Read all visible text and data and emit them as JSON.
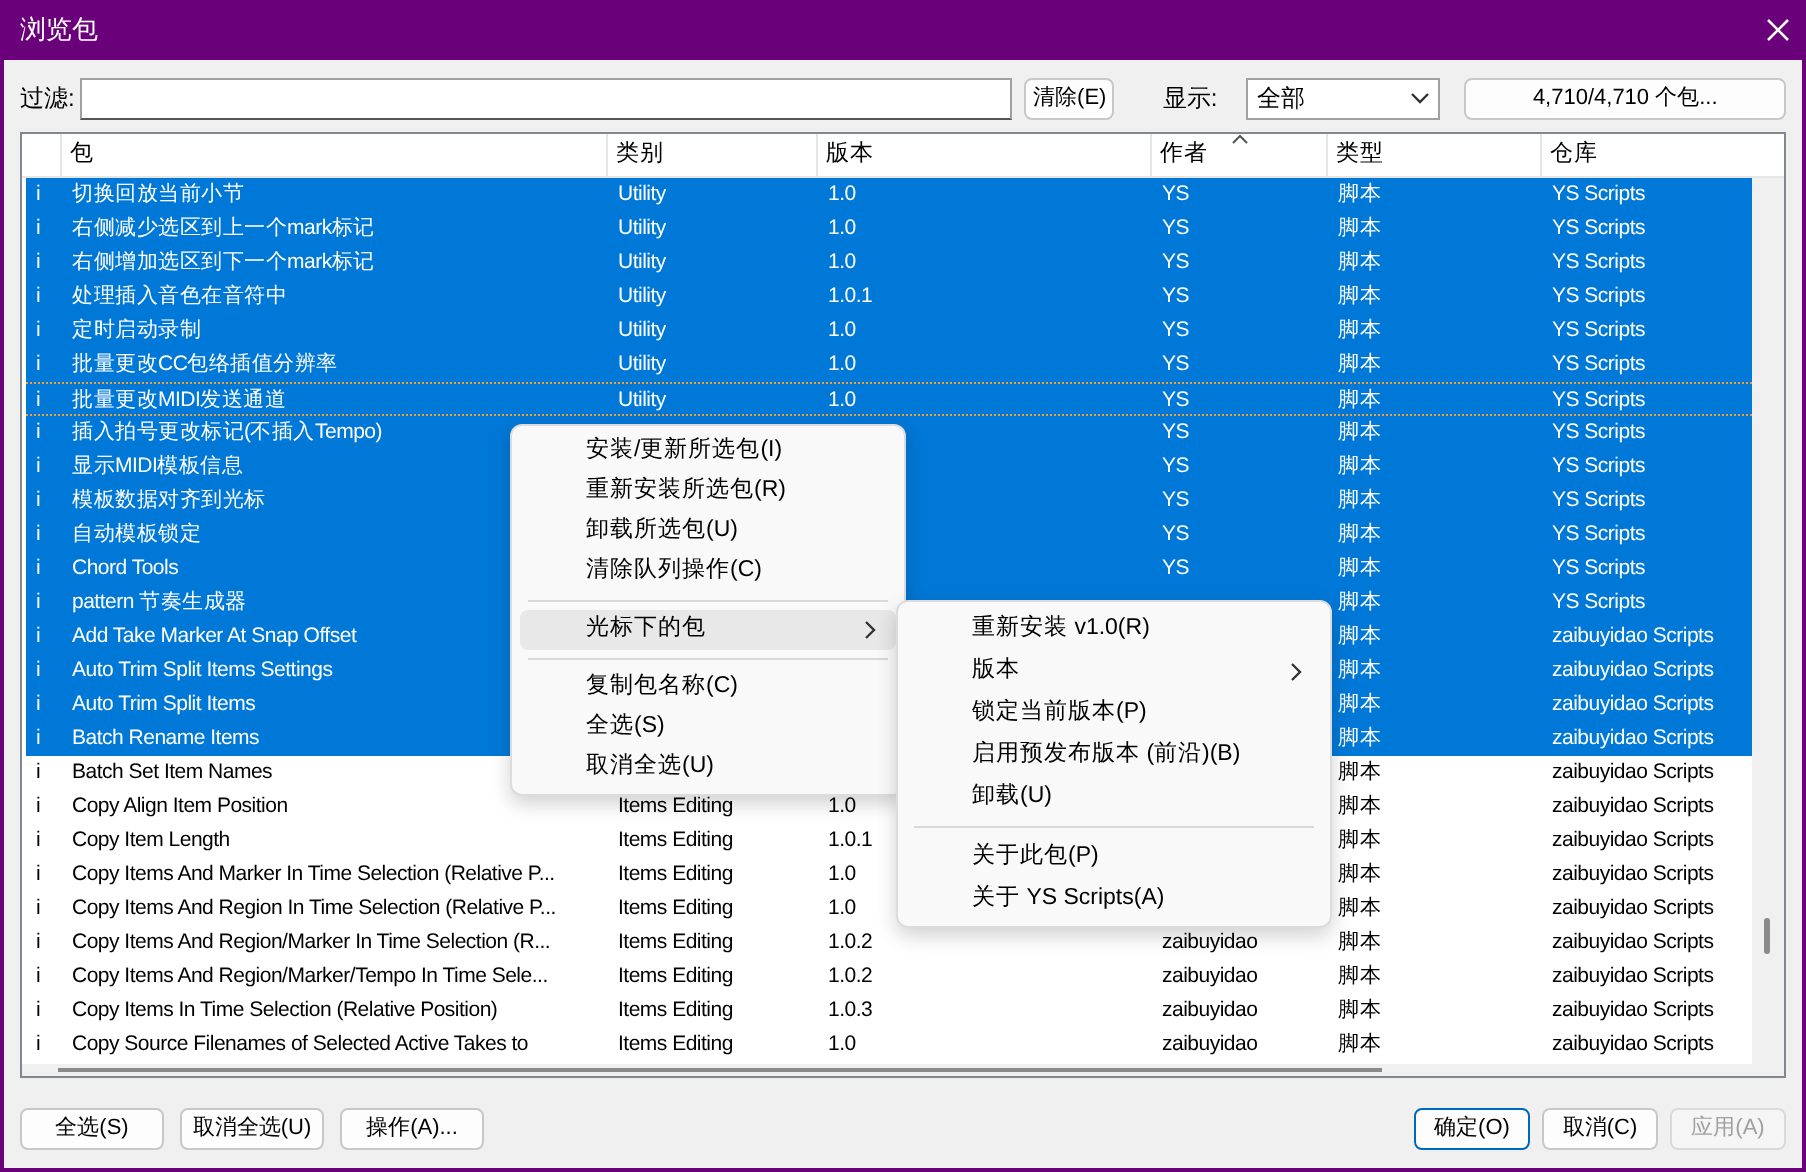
{
  "window": {
    "title": "浏览包"
  },
  "filter": {
    "label": "过滤:",
    "clear_button": "清除(E)",
    "show_label": "显示:",
    "show_value": "全部",
    "count_button": "4,710/4,710 个包..."
  },
  "table": {
    "columns": [
      {
        "sorted": false
      },
      {
        "label": "包",
        "sorted": false
      },
      {
        "label": "类别",
        "sorted": false
      },
      {
        "label": "版本",
        "sorted": false
      },
      {
        "label": "作者",
        "sorted": true
      },
      {
        "label": "类型",
        "sorted": false
      },
      {
        "label": "仓库",
        "sorted": false
      }
    ],
    "rows": [
      {
        "flag": "i",
        "name": "切换回放当前小节",
        "category": "Utility",
        "version": "1.0",
        "author": "YS",
        "type": "脚本",
        "repo": "YS Scripts",
        "selected": true,
        "focused": false
      },
      {
        "flag": "i",
        "name": "右侧减少选区到上一个mark标记",
        "category": "Utility",
        "version": "1.0",
        "author": "YS",
        "type": "脚本",
        "repo": "YS Scripts",
        "selected": true,
        "focused": false
      },
      {
        "flag": "i",
        "name": "右侧增加选区到下一个mark标记",
        "category": "Utility",
        "version": "1.0",
        "author": "YS",
        "type": "脚本",
        "repo": "YS Scripts",
        "selected": true,
        "focused": false
      },
      {
        "flag": "i",
        "name": "处理插入音色在音符中",
        "category": "Utility",
        "version": "1.0.1",
        "author": "YS",
        "type": "脚本",
        "repo": "YS Scripts",
        "selected": true,
        "focused": false
      },
      {
        "flag": "i",
        "name": "定时启动录制",
        "category": "Utility",
        "version": "1.0",
        "author": "YS",
        "type": "脚本",
        "repo": "YS Scripts",
        "selected": true,
        "focused": false
      },
      {
        "flag": "i",
        "name": "批量更改CC包络插值分辨率",
        "category": "Utility",
        "version": "1.0",
        "author": "YS",
        "type": "脚本",
        "repo": "YS Scripts",
        "selected": true,
        "focused": false
      },
      {
        "flag": "i",
        "name": "批量更改MIDI发送通道",
        "category": "Utility",
        "version": "1.0",
        "author": "YS",
        "type": "脚本",
        "repo": "YS Scripts",
        "selected": true,
        "focused": true
      },
      {
        "flag": "i",
        "name": "插入拍号更改标记(不插入Tempo)",
        "author": "YS",
        "type": "脚本",
        "repo": "YS Scripts",
        "selected": true,
        "focused": false
      },
      {
        "flag": "i",
        "name": "显示MIDI模板信息",
        "author": "YS",
        "type": "脚本",
        "repo": "YS Scripts",
        "selected": true,
        "focused": false
      },
      {
        "flag": "i",
        "name": "模板数据对齐到光标",
        "author": "YS",
        "type": "脚本",
        "repo": "YS Scripts",
        "selected": true,
        "focused": false
      },
      {
        "flag": "i",
        "name": "自动模板锁定",
        "author": "YS",
        "type": "脚本",
        "repo": "YS Scripts",
        "selected": true,
        "focused": false
      },
      {
        "flag": "i",
        "name": "Chord Tools",
        "author": "YS",
        "type": "脚本",
        "repo": "YS Scripts",
        "selected": true,
        "focused": false
      },
      {
        "flag": "i",
        "name": "pattern 节奏生成器",
        "type": "脚本",
        "repo": "YS Scripts",
        "selected": true,
        "focused": false
      },
      {
        "flag": "i",
        "name": "Add Take Marker At Snap Offset",
        "type": "脚本",
        "repo": "zaibuyidao Scripts",
        "selected": true,
        "focused": false
      },
      {
        "flag": "i",
        "name": "Auto Trim Split Items Settings",
        "type": "脚本",
        "repo": "zaibuyidao Scripts",
        "selected": true,
        "focused": false
      },
      {
        "flag": "i",
        "name": "Auto Trim Split Items",
        "type": "脚本",
        "repo": "zaibuyidao Scripts",
        "selected": true,
        "focused": false
      },
      {
        "flag": "i",
        "name": "Batch Rename Items",
        "type": "脚本",
        "repo": "zaibuyidao Scripts",
        "selected": true,
        "focused": false
      },
      {
        "flag": "i",
        "name": "Batch Set Item Names",
        "type": "脚本",
        "repo": "zaibuyidao Scripts",
        "selected": false,
        "focused": false
      },
      {
        "flag": "i",
        "name": "Copy Align Item Position",
        "category": "Items Editing",
        "version": "1.0",
        "type": "脚本",
        "repo": "zaibuyidao Scripts",
        "selected": false,
        "focused": false
      },
      {
        "flag": "i",
        "name": "Copy Item Length",
        "category": "Items Editing",
        "version": "1.0.1",
        "type": "脚本",
        "repo": "zaibuyidao Scripts",
        "selected": false,
        "focused": false
      },
      {
        "flag": "i",
        "name": "Copy Items And Marker In Time Selection (Relative P...",
        "category": "Items Editing",
        "version": "1.0",
        "type": "脚本",
        "repo": "zaibuyidao Scripts",
        "selected": false,
        "focused": false
      },
      {
        "flag": "i",
        "name": "Copy Items And Region In Time Selection (Relative P...",
        "category": "Items Editing",
        "version": "1.0",
        "type": "脚本",
        "repo": "zaibuyidao Scripts",
        "selected": false,
        "focused": false
      },
      {
        "flag": "i",
        "name": "Copy Items And Region/Marker In Time Selection (R...",
        "category": "Items Editing",
        "version": "1.0.2",
        "author": "zaibuyidao",
        "type": "脚本",
        "repo": "zaibuyidao Scripts",
        "selected": false,
        "focused": false
      },
      {
        "flag": "i",
        "name": "Copy Items And Region/Marker/Tempo In Time Sele...",
        "category": "Items Editing",
        "version": "1.0.2",
        "author": "zaibuyidao",
        "type": "脚本",
        "repo": "zaibuyidao Scripts",
        "selected": false,
        "focused": false
      },
      {
        "flag": "i",
        "name": "Copy Items In Time Selection (Relative Position)",
        "category": "Items Editing",
        "version": "1.0.3",
        "author": "zaibuyidao",
        "type": "脚本",
        "repo": "zaibuyidao Scripts",
        "selected": false,
        "focused": false
      },
      {
        "flag": "i",
        "name": "Copy Source Filenames of Selected Active Takes to",
        "category": "Items Editing",
        "version": "1.0",
        "author": "zaibuyidao",
        "type": "脚本",
        "repo": "zaibuyidao Scripts",
        "selected": false,
        "focused": false
      }
    ]
  },
  "context_menu": {
    "items": [
      {
        "kind": "item",
        "label": "安装/更新所选包(I)",
        "selected": false
      },
      {
        "kind": "item",
        "label": "重新安装所选包(R)",
        "selected": false
      },
      {
        "kind": "item",
        "label": "卸载所选包(U)",
        "selected": false
      },
      {
        "kind": "item",
        "label": "清除队列操作(C)",
        "selected": false
      },
      {
        "kind": "separator"
      },
      {
        "kind": "submenu",
        "label": "光标下的包",
        "selected": true
      },
      {
        "kind": "separator"
      },
      {
        "kind": "item",
        "label": "复制包名称(C)",
        "selected": false
      },
      {
        "kind": "item",
        "label": "全选(S)",
        "selected": false
      },
      {
        "kind": "item",
        "label": "取消全选(U)",
        "selected": false
      }
    ]
  },
  "submenu": {
    "items": [
      {
        "kind": "item",
        "label": "重新安装 v1.0(R)",
        "selected": false
      },
      {
        "kind": "submenu",
        "label": "版本",
        "selected": false
      },
      {
        "kind": "item",
        "label": "锁定当前版本(P)",
        "selected": false
      },
      {
        "kind": "item",
        "label": "启用预发布版本 (前沿)(B)",
        "selected": false
      },
      {
        "kind": "item",
        "label": "卸载(U)",
        "selected": false
      },
      {
        "kind": "separator"
      },
      {
        "kind": "item",
        "label": "关于此包(P)",
        "selected": false
      },
      {
        "kind": "item",
        "label": "关于 YS Scripts(A)",
        "selected": false
      }
    ]
  },
  "bottom_left_buttons": [
    "全选(S)",
    "取消全选(U)",
    "操作(A)..."
  ],
  "dialog_buttons": [
    {
      "label": "确定(O)",
      "default": true,
      "disabled": false
    },
    {
      "label": "取消(C)",
      "default": false,
      "disabled": false
    },
    {
      "label": "应用(A)",
      "default": false,
      "disabled": true
    }
  ]
}
